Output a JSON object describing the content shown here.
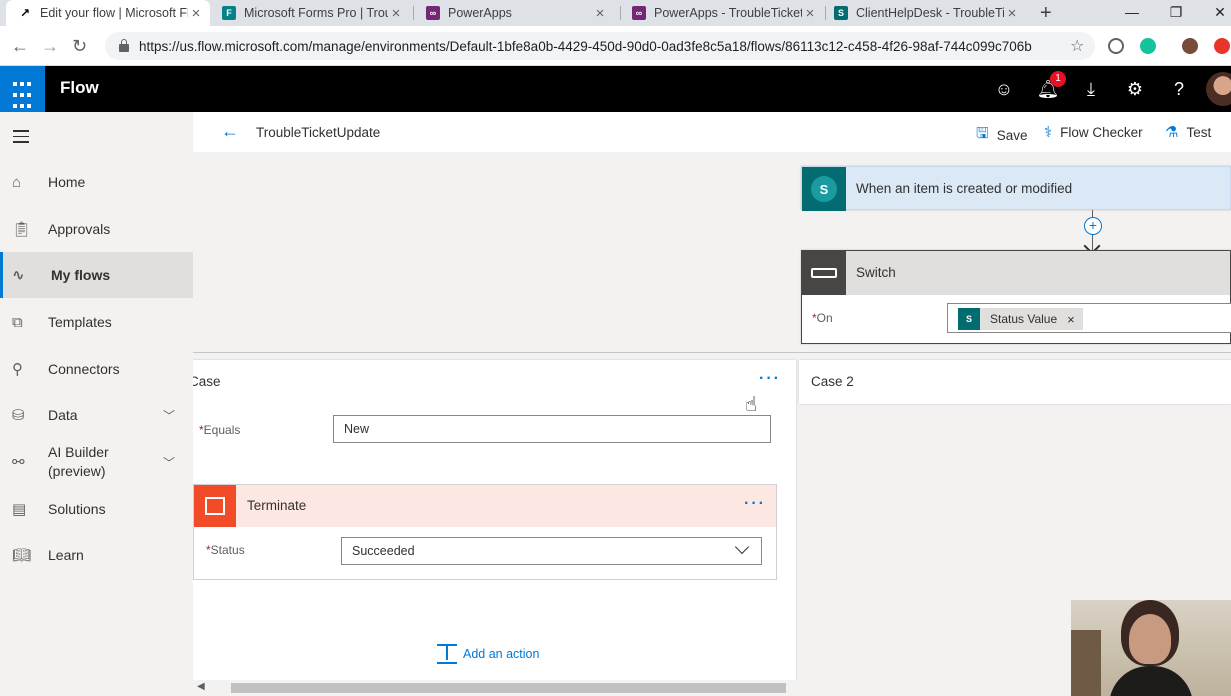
{
  "browser": {
    "tabs": [
      {
        "title": "Edit your flow | Microsoft Fl",
        "favicon": "flow-icon",
        "color": "#000000"
      },
      {
        "title": "Microsoft Forms Pro | Troub",
        "favicon": "forms-icon",
        "color": "#038387"
      },
      {
        "title": "PowerApps",
        "favicon": "powerapps-icon",
        "color": "#742774"
      },
      {
        "title": "PowerApps - TroubleTicket",
        "favicon": "powerapps-icon",
        "color": "#742774"
      },
      {
        "title": "ClientHelpDesk - TroubleTi",
        "favicon": "sharepoint-icon",
        "color": "#036c70"
      }
    ],
    "new_tab": "+",
    "minimize": "—",
    "restore": "❐",
    "close": "✕",
    "url": "https://us.flow.microsoft.com/manage/environments/Default-1bfe8a0b-4429-450d-90d0-0ad3fe8c5a18/flows/86113c12-c458-4f26-98af-744c099c706b"
  },
  "header": {
    "app_name": "Flow",
    "notification_count": "1",
    "accent": "#0078d4"
  },
  "sidebar": {
    "items": [
      {
        "label": "Home",
        "icon": "home-icon"
      },
      {
        "label": "Approvals",
        "icon": "clipboard-icon"
      },
      {
        "label": "My flows",
        "icon": "flows-icon",
        "selected": true
      },
      {
        "label": "Templates",
        "icon": "templates-icon"
      },
      {
        "label": "Connectors",
        "icon": "connector-icon"
      },
      {
        "label": "Data",
        "icon": "database-icon",
        "expandable": true
      },
      {
        "label": "AI Builder\n(preview)",
        "icon": "ai-icon",
        "expandable": true
      },
      {
        "label": "Solutions",
        "icon": "solutions-icon"
      },
      {
        "label": "Learn",
        "icon": "book-icon"
      }
    ]
  },
  "toolbar": {
    "flow_name": "TroubleTicketUpdate",
    "save": "Save",
    "flow_checker": "Flow Checker",
    "test": "Test"
  },
  "designer": {
    "trigger": {
      "title": "When an item is created or modified",
      "icon_text": "S"
    },
    "switch": {
      "title": "Switch",
      "on_label": "On",
      "token": "Status Value",
      "token_icon": "S"
    },
    "case1": {
      "title": "Case",
      "equals_label": "Equals",
      "equals_value": "New",
      "terminate": {
        "title": "Terminate",
        "status_label": "Status",
        "status_value": "Succeeded"
      },
      "add_action": "Add an action"
    },
    "case2": {
      "title": "Case 2"
    },
    "more": "···",
    "required_mark": "*"
  }
}
